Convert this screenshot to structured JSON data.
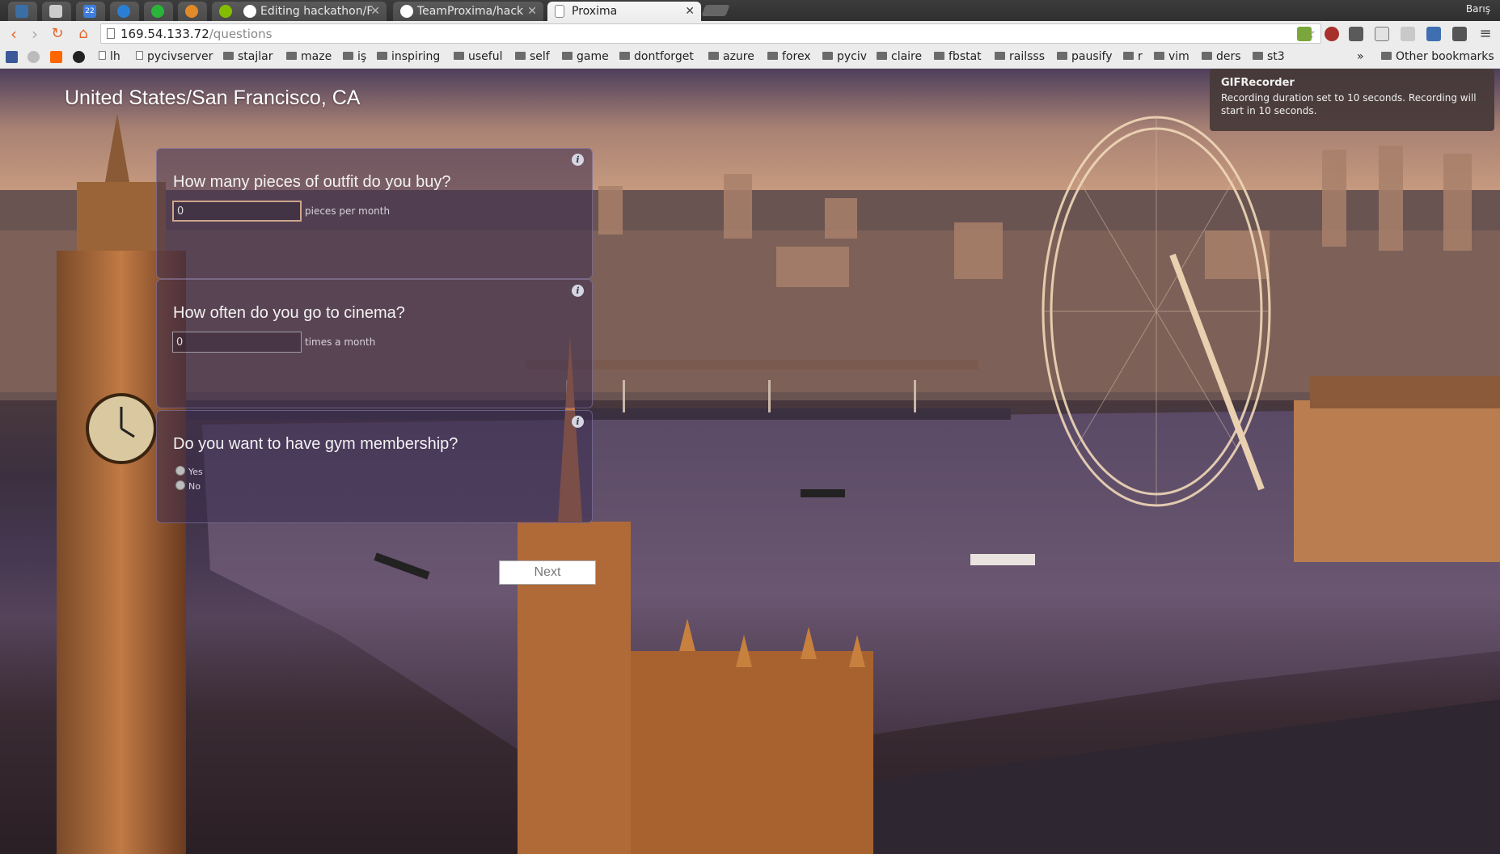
{
  "browser": {
    "tabs": [
      {
        "label": "",
        "icon": "mail-icon",
        "color": "#3a6ea5"
      },
      {
        "label": "",
        "icon": "image-icon",
        "color": "#cccccc"
      },
      {
        "label": "22",
        "icon": "calendar-icon",
        "color": "#3d7ee0"
      },
      {
        "label": "",
        "icon": "messenger-icon",
        "color": "#2a7fd4"
      },
      {
        "label": "",
        "icon": "whatsapp-icon",
        "color": "#2ab43a"
      },
      {
        "label": "",
        "icon": "firefox-icon",
        "color": "#e08a2a"
      },
      {
        "label": "",
        "icon": "spotify-icon",
        "color": "#84bd00"
      },
      {
        "label": "Editing hackathon/F",
        "icon": "github-icon"
      },
      {
        "label": "TeamProxima/hack",
        "icon": "github-icon"
      },
      {
        "label": "Proxima",
        "icon": "page-icon"
      }
    ],
    "profile_name": "Barış",
    "url_host": "169.54.133.72",
    "url_path": "/questions",
    "bookmarks": [
      "lh",
      "pycivserver",
      "stajlar",
      "maze",
      "iş",
      "inspiring",
      "useful",
      "self",
      "game",
      "dontforget",
      "azure",
      "forex",
      "pyciv",
      "claire",
      "fbstat",
      "railsss",
      "pausify",
      "r",
      "vim",
      "ders",
      "st3"
    ],
    "other_bookmarks": "Other bookmarks",
    "overflow_glyph": "»"
  },
  "page": {
    "location": "United States/San Francisco, CA",
    "questions": [
      {
        "title": "How many pieces of outfit do you buy?",
        "value": "0",
        "unit": "pieces per month"
      },
      {
        "title": "How often do you go to cinema?",
        "value": "0",
        "unit": "times a month"
      },
      {
        "title": "Do you want to have gym membership?",
        "options": [
          "Yes",
          "No"
        ]
      }
    ],
    "info_glyph": "i",
    "next_label": "Next"
  },
  "notification": {
    "title": "GIFRecorder",
    "body": "Recording duration set to 10 seconds. Recording will start in 10 seconds."
  }
}
